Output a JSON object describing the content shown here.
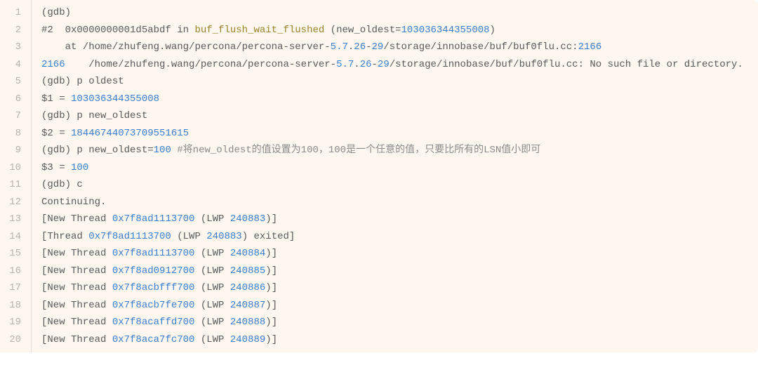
{
  "lines": [
    {
      "num": "1",
      "segments": [
        {
          "text": "(gdb)",
          "cls": "c-default"
        }
      ]
    },
    {
      "num": "2",
      "segments": [
        {
          "text": "#2  0x0000000001d5abdf in ",
          "cls": "c-default"
        },
        {
          "text": "buf_flush_wait_flushed",
          "cls": "c-olive"
        },
        {
          "text": " (new_oldest=",
          "cls": "c-default"
        },
        {
          "text": "103036344355008",
          "cls": "c-blue"
        },
        {
          "text": ")",
          "cls": "c-default"
        }
      ]
    },
    {
      "num": "3",
      "segments": [
        {
          "text": "    at /home/zhufeng.wang/percona/percona-server-",
          "cls": "c-default"
        },
        {
          "text": "5.7",
          "cls": "c-blue"
        },
        {
          "text": ".",
          "cls": "c-default"
        },
        {
          "text": "26",
          "cls": "c-blue"
        },
        {
          "text": "-",
          "cls": "c-default"
        },
        {
          "text": "29",
          "cls": "c-blue"
        },
        {
          "text": "/storage/innobase/buf/buf0flu.cc:",
          "cls": "c-default"
        },
        {
          "text": "2166",
          "cls": "c-blue"
        }
      ]
    },
    {
      "num": "4",
      "segments": [
        {
          "text": "2166",
          "cls": "c-blue"
        },
        {
          "text": "    /home/zhufeng.wang/percona/percona-server-",
          "cls": "c-default"
        },
        {
          "text": "5.7",
          "cls": "c-blue"
        },
        {
          "text": ".",
          "cls": "c-default"
        },
        {
          "text": "26",
          "cls": "c-blue"
        },
        {
          "text": "-",
          "cls": "c-default"
        },
        {
          "text": "29",
          "cls": "c-blue"
        },
        {
          "text": "/storage/innobase/buf/buf0flu.cc: No such file or directory.",
          "cls": "c-default"
        }
      ]
    },
    {
      "num": "5",
      "segments": [
        {
          "text": "(gdb) p oldest",
          "cls": "c-default"
        }
      ]
    },
    {
      "num": "6",
      "segments": [
        {
          "text": "$1 = ",
          "cls": "c-default"
        },
        {
          "text": "103036344355008",
          "cls": "c-blue"
        }
      ]
    },
    {
      "num": "7",
      "segments": [
        {
          "text": "(gdb) p new_oldest",
          "cls": "c-default"
        }
      ]
    },
    {
      "num": "8",
      "segments": [
        {
          "text": "$2 = ",
          "cls": "c-default"
        },
        {
          "text": "18446744073709551615",
          "cls": "c-blue"
        }
      ]
    },
    {
      "num": "9",
      "segments": [
        {
          "text": "(gdb) p new_oldest=",
          "cls": "c-default"
        },
        {
          "text": "100",
          "cls": "c-blue"
        },
        {
          "text": " ",
          "cls": "c-default"
        },
        {
          "text": "#将new_oldest的值设置为100，100是一个任意的值，只要比所有的LSN值小即可",
          "cls": "c-comment"
        }
      ]
    },
    {
      "num": "10",
      "segments": [
        {
          "text": "$3 = ",
          "cls": "c-default"
        },
        {
          "text": "100",
          "cls": "c-blue"
        }
      ]
    },
    {
      "num": "11",
      "segments": [
        {
          "text": "(gdb) c",
          "cls": "c-default"
        }
      ]
    },
    {
      "num": "12",
      "segments": [
        {
          "text": "Continuing.",
          "cls": "c-default"
        }
      ]
    },
    {
      "num": "13",
      "segments": [
        {
          "text": "[New Thread ",
          "cls": "c-default"
        },
        {
          "text": "0x7f8ad1113700",
          "cls": "c-blue"
        },
        {
          "text": " (LWP ",
          "cls": "c-default"
        },
        {
          "text": "240883",
          "cls": "c-blue"
        },
        {
          "text": ")]",
          "cls": "c-default"
        }
      ]
    },
    {
      "num": "14",
      "segments": [
        {
          "text": "[Thread ",
          "cls": "c-default"
        },
        {
          "text": "0x7f8ad1113700",
          "cls": "c-blue"
        },
        {
          "text": " (LWP ",
          "cls": "c-default"
        },
        {
          "text": "240883",
          "cls": "c-blue"
        },
        {
          "text": ") exited]",
          "cls": "c-default"
        }
      ]
    },
    {
      "num": "15",
      "segments": [
        {
          "text": "[New Thread ",
          "cls": "c-default"
        },
        {
          "text": "0x7f8ad1113700",
          "cls": "c-blue"
        },
        {
          "text": " (LWP ",
          "cls": "c-default"
        },
        {
          "text": "240884",
          "cls": "c-blue"
        },
        {
          "text": ")]",
          "cls": "c-default"
        }
      ]
    },
    {
      "num": "16",
      "segments": [
        {
          "text": "[New Thread ",
          "cls": "c-default"
        },
        {
          "text": "0x7f8ad0912700",
          "cls": "c-blue"
        },
        {
          "text": " (LWP ",
          "cls": "c-default"
        },
        {
          "text": "240885",
          "cls": "c-blue"
        },
        {
          "text": ")]",
          "cls": "c-default"
        }
      ]
    },
    {
      "num": "17",
      "segments": [
        {
          "text": "[New Thread ",
          "cls": "c-default"
        },
        {
          "text": "0x7f8acbfff700",
          "cls": "c-blue"
        },
        {
          "text": " (LWP ",
          "cls": "c-default"
        },
        {
          "text": "240886",
          "cls": "c-blue"
        },
        {
          "text": ")]",
          "cls": "c-default"
        }
      ]
    },
    {
      "num": "18",
      "segments": [
        {
          "text": "[New Thread ",
          "cls": "c-default"
        },
        {
          "text": "0x7f8acb7fe700",
          "cls": "c-blue"
        },
        {
          "text": " (LWP ",
          "cls": "c-default"
        },
        {
          "text": "240887",
          "cls": "c-blue"
        },
        {
          "text": ")]",
          "cls": "c-default"
        }
      ]
    },
    {
      "num": "19",
      "segments": [
        {
          "text": "[New Thread ",
          "cls": "c-default"
        },
        {
          "text": "0x7f8acaffd700",
          "cls": "c-blue"
        },
        {
          "text": " (LWP ",
          "cls": "c-default"
        },
        {
          "text": "240888",
          "cls": "c-blue"
        },
        {
          "text": ")]",
          "cls": "c-default"
        }
      ]
    },
    {
      "num": "20",
      "segments": [
        {
          "text": "[New Thread ",
          "cls": "c-default"
        },
        {
          "text": "0x7f8aca7fc700",
          "cls": "c-blue"
        },
        {
          "text": " (LWP ",
          "cls": "c-default"
        },
        {
          "text": "240889",
          "cls": "c-blue"
        },
        {
          "text": ")]",
          "cls": "c-default"
        }
      ]
    }
  ]
}
